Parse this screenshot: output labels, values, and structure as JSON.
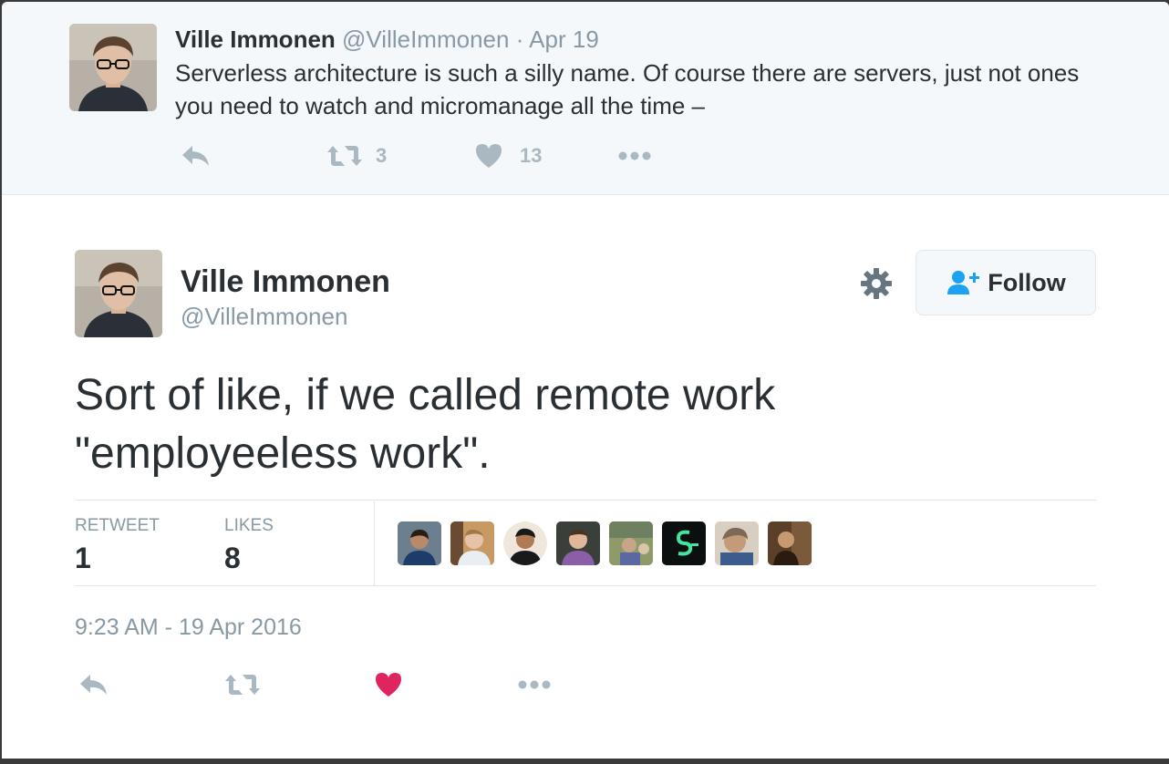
{
  "parent_tweet": {
    "name": "Ville Immonen",
    "handle": "@VilleImmonen",
    "separator": "·",
    "date": "Apr 19",
    "text": "Serverless architecture is such a silly name. Of course there are servers, just not ones you need to watch and micromanage all the time –",
    "retweet_count": "3",
    "like_count": "13"
  },
  "main_tweet": {
    "name": "Ville Immonen",
    "handle": "@VilleImmonen",
    "follow_label": "Follow",
    "text_line1": "Sort of like, if we called remote work",
    "text_line2": "\"employeeless work\".",
    "stats": {
      "retweet_label": "RETWEET",
      "retweet_value": "1",
      "likes_label": "LIKES",
      "likes_value": "8"
    },
    "timestamp": "9:23 AM - 19 Apr 2016",
    "liked": true
  },
  "icons": [
    "reply-icon",
    "retweet-icon",
    "heart-icon",
    "more-icon",
    "gear-icon",
    "follow-person-icon"
  ],
  "colors": {
    "like_active": "#e0245e",
    "icon_gray": "#aab8c2",
    "text_primary": "#292f33",
    "text_secondary": "#8899a6",
    "follow_icon": "#1da1f2"
  }
}
